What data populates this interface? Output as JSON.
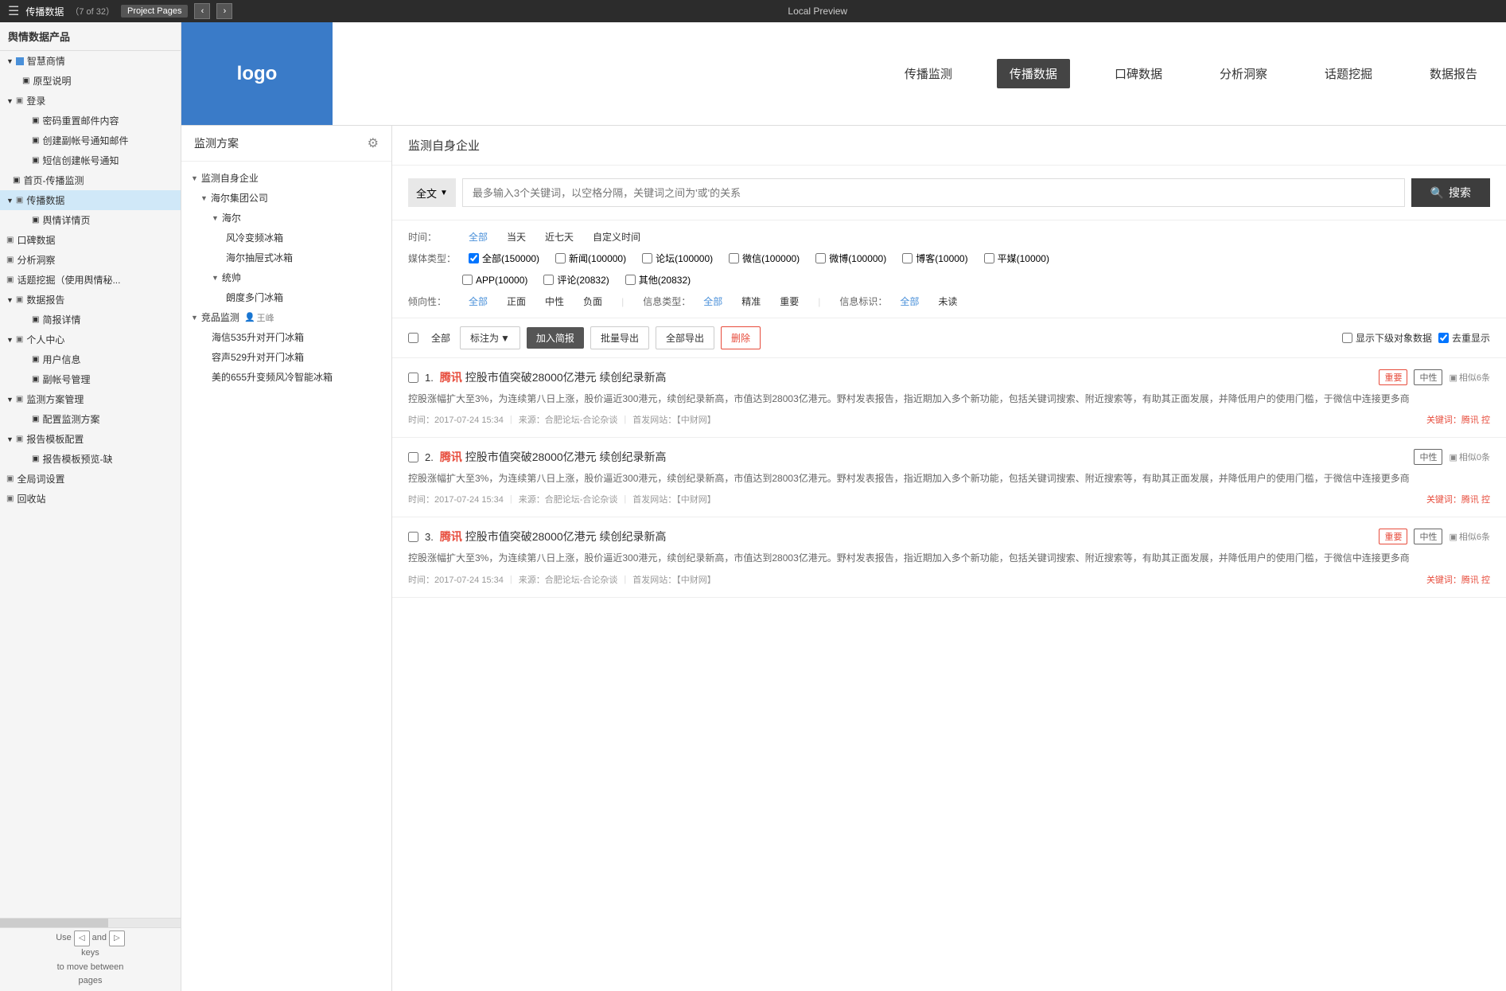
{
  "topBar": {
    "leftIcon": "☰",
    "title": "传播数据",
    "pageInfo": "（7 of 32）",
    "projectPages": "Project Pages",
    "prevBtn": "‹",
    "nextBtn": "›",
    "centerTitle": "Local Preview"
  },
  "leftPanel": {
    "header": "舆情数据产品",
    "navItems": [
      {
        "label": "智慧商情",
        "indent": 0,
        "type": "section",
        "expanded": true
      },
      {
        "label": "原型说明",
        "indent": 1,
        "type": "file"
      },
      {
        "label": "登录",
        "indent": 0,
        "type": "section",
        "expanded": true
      },
      {
        "label": "密码重置邮件内容",
        "indent": 2,
        "type": "file"
      },
      {
        "label": "创建副帐号通知邮件",
        "indent": 2,
        "type": "file"
      },
      {
        "label": "短信创建帐号通知",
        "indent": 2,
        "type": "file"
      },
      {
        "label": "首页-传播监测",
        "indent": 1,
        "type": "file"
      },
      {
        "label": "传播数据",
        "indent": 0,
        "type": "section",
        "expanded": true,
        "active": true
      },
      {
        "label": "舆情详情页",
        "indent": 2,
        "type": "file"
      },
      {
        "label": "口碑数据",
        "indent": 0,
        "type": "file"
      },
      {
        "label": "分析洞察",
        "indent": 0,
        "type": "file"
      },
      {
        "label": "话题挖掘（使用舆情秘...",
        "indent": 0,
        "type": "file"
      },
      {
        "label": "数据报告",
        "indent": 0,
        "type": "section",
        "expanded": true
      },
      {
        "label": "简报详情",
        "indent": 2,
        "type": "file"
      },
      {
        "label": "个人中心",
        "indent": 0,
        "type": "section",
        "expanded": true
      },
      {
        "label": "用户信息",
        "indent": 2,
        "type": "file"
      },
      {
        "label": "副帐号管理",
        "indent": 2,
        "type": "file"
      },
      {
        "label": "监测方案管理",
        "indent": 0,
        "type": "section",
        "expanded": true
      },
      {
        "label": "配置监测方案",
        "indent": 2,
        "type": "file"
      },
      {
        "label": "报告模板配置",
        "indent": 0,
        "type": "section",
        "expanded": true
      },
      {
        "label": "报告模板预览-缺",
        "indent": 2,
        "type": "file"
      },
      {
        "label": "全局词设置",
        "indent": 0,
        "type": "file"
      },
      {
        "label": "回收站",
        "indent": 0,
        "type": "file"
      }
    ],
    "bottomText": "Use",
    "andText": "and",
    "keysText": "keys",
    "toMoveText": "to move between",
    "pagesText": "pages",
    "prevKeySymbol": "◁",
    "nextKeySymbol": "▷"
  },
  "appHeader": {
    "logo": "logo",
    "navItems": [
      {
        "label": "传播监测",
        "active": false
      },
      {
        "label": "传播数据",
        "active": true
      },
      {
        "label": "口碑数据",
        "active": false
      },
      {
        "label": "分析洞察",
        "active": false
      },
      {
        "label": "话题挖掘",
        "active": false
      },
      {
        "label": "数据报告",
        "active": false
      }
    ]
  },
  "monitorSidebar": {
    "title": "监测方案",
    "settingsIcon": "⚙",
    "tree": [
      {
        "label": "监测自身企业",
        "indent": 0,
        "arrow": "▼"
      },
      {
        "label": "海尔集团公司",
        "indent": 1,
        "arrow": "▼"
      },
      {
        "label": "海尔",
        "indent": 2,
        "arrow": "▼"
      },
      {
        "label": "风冷变频冰箱",
        "indent": 3,
        "arrow": ""
      },
      {
        "label": "海尔抽屉式冰箱",
        "indent": 3,
        "arrow": ""
      },
      {
        "label": "统帅",
        "indent": 2,
        "arrow": "▼"
      },
      {
        "label": "朗度多门冰箱",
        "indent": 3,
        "arrow": ""
      },
      {
        "label": "竞品监测",
        "indent": 0,
        "arrow": "▼",
        "user": "王峰"
      },
      {
        "label": "海信535升对开门冰箱",
        "indent": 2,
        "arrow": ""
      },
      {
        "label": "容声529升对开门冰箱",
        "indent": 2,
        "arrow": ""
      },
      {
        "label": "美的655升变频风冷智能冰箱",
        "indent": 2,
        "arrow": ""
      }
    ]
  },
  "rightPanel": {
    "title": "监测自身企业",
    "searchScope": "全文",
    "searchPlaceholder": "最多输入3个关键词，以空格分隔，关键词之间为'或'的关系",
    "searchBtn": "搜索",
    "filters": {
      "time": {
        "label": "时间：",
        "options": [
          "全部",
          "当天",
          "近七天",
          "自定义时间"
        ]
      },
      "mediaType": {
        "label": "媒体类型：",
        "options": [
          {
            "label": "全部(150000)",
            "checked": true
          },
          {
            "label": "新闻(100000)",
            "checked": false
          },
          {
            "label": "论坛(100000)",
            "checked": false
          },
          {
            "label": "微信(100000)",
            "checked": false
          },
          {
            "label": "微博(100000)",
            "checked": false
          },
          {
            "label": "博客(10000)",
            "checked": false
          },
          {
            "label": "平媒(10000)",
            "checked": false
          },
          {
            "label": "APP(10000)",
            "checked": false
          },
          {
            "label": "评论(20832)",
            "checked": false
          },
          {
            "label": "其他(20832)",
            "checked": false
          }
        ]
      },
      "tendency": {
        "label": "倾向性：",
        "options": [
          "全部",
          "正面",
          "中性",
          "负面"
        ]
      },
      "infoType": {
        "label": "信息类型：",
        "options": [
          "全部",
          "精准",
          "重要"
        ]
      },
      "infoMark": {
        "label": "信息标识：",
        "options": [
          "全部",
          "未读"
        ]
      }
    },
    "actionBar": {
      "allLabel": "全部",
      "markAsBtn": "标注为",
      "addToReportBtn": "加入简报",
      "batchExportBtn": "批量导出",
      "allExportBtn": "全部导出",
      "deleteBtn": "删除",
      "showSubObject": "显示下级对象数据",
      "dedup": "去重显示"
    },
    "articles": [
      {
        "num": "1.",
        "titleKeyword": "腾讯",
        "titleRest": " 控股市值突破28000亿港元 续创纪录新高",
        "tags": [
          "重要",
          "中性"
        ],
        "similar": "相似6条",
        "body": "控股涨幅扩大至3%，为连续第八日上涨，股价逼近300港元，续创纪录新高，市值达到28003亿港元。野村发表报告，指近期加入多个新功能，包括关键词搜索、附近搜索等，有助其正面发展，并降低用户的使用门槛，于微信中连接更多商",
        "time": "时间：2017-07-24 15:34",
        "source": "来源：合肥论坛-合论杂谈",
        "website": "首发网站：【中财网】",
        "keyword": "关键词：腾讯 控"
      },
      {
        "num": "2.",
        "titleKeyword": "腾讯",
        "titleRest": " 控股市值突破28000亿港元 续创纪录新高",
        "tags": [
          "中性"
        ],
        "similar": "相似0条",
        "body": "控股涨幅扩大至3%，为连续第八日上涨，股价逼近300港元，续创纪录新高，市值达到28003亿港元。野村发表报告，指近期加入多个新功能，包括关键词搜索、附近搜索等，有助其正面发展，并降低用户的使用门槛，于微信中连接更多商",
        "time": "时间：2017-07-24 15:34",
        "source": "来源：合肥论坛-合论杂谈",
        "website": "首发网站：【中财网】",
        "keyword": "关键词：腾讯 控"
      },
      {
        "num": "3.",
        "titleKeyword": "腾讯",
        "titleRest": " 控股市值突破28000亿港元 续创纪录新高",
        "tags": [
          "重要",
          "中性"
        ],
        "similar": "相似6条",
        "body": "控股涨幅扩大至3%，为连续第八日上涨，股价逼近300港元，续创纪录新高，市值达到28003亿港元。野村发表报告，指近期加入多个新功能，包括关键词搜索、附近搜索等，有助其正面发展，并降低用户的使用门槛，于微信中连接更多商",
        "time": "时间：2017-07-24 15:34",
        "source": "来源：合肥论坛-合论杂谈",
        "website": "首发网站：【中财网】",
        "keyword": "关键词：腾讯 控"
      }
    ]
  }
}
